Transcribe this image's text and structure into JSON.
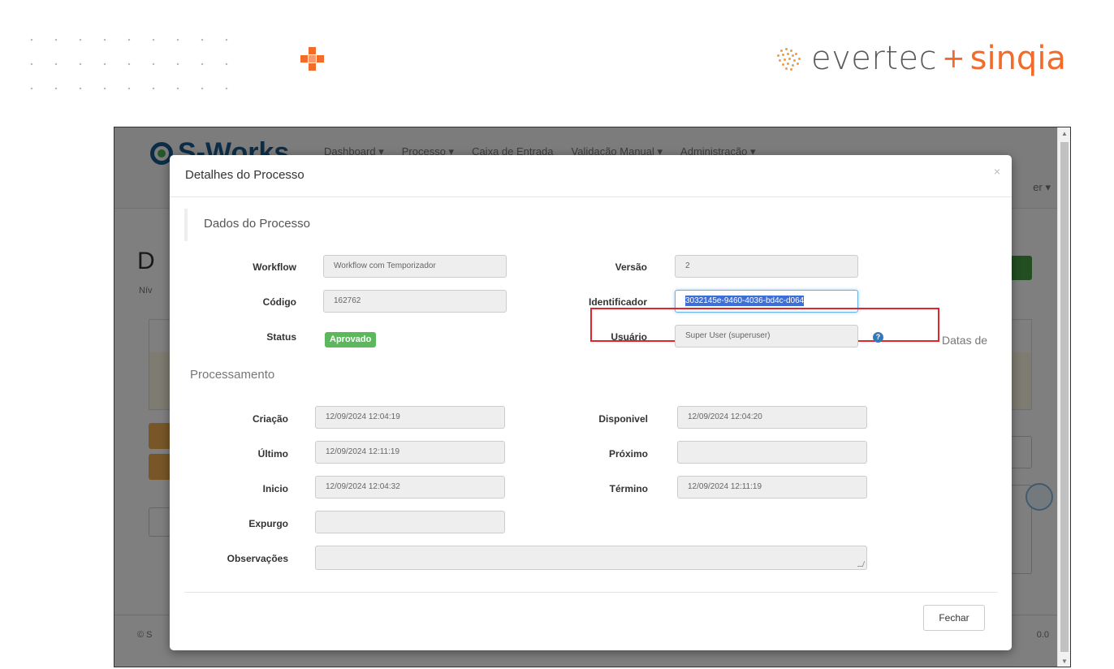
{
  "slide": {
    "logo_word1": "evertec",
    "logo_plus": "+",
    "logo_word2": "sinqia",
    "accent_color": "#f26b2a"
  },
  "app": {
    "brand": "S-Works",
    "nav": [
      "Dashboard ▾",
      "Processo ▾",
      "Caixa de Entrada",
      "Validação Manual ▾",
      "Administração ▾"
    ],
    "user_menu": "er ▾",
    "page_title": "D",
    "page_sub": "Nív",
    "footer_left": "© S",
    "footer_right": "0.0"
  },
  "modal": {
    "title": "Detalhes do Processo",
    "close": "×",
    "section_title": "Dados do Processo",
    "fields": {
      "workflow": {
        "label": "Workflow",
        "value": "Workflow com Temporizador"
      },
      "versao": {
        "label": "Versão",
        "value": "2"
      },
      "codigo": {
        "label": "Código",
        "value": "162762"
      },
      "identificador": {
        "label": "Identificador",
        "value": "3032145e-9460-4036-bd4c-d064"
      },
      "status": {
        "label": "Status",
        "value": "Aprovado"
      },
      "usuario": {
        "label": "Usuário",
        "value": "Super User (superuser)"
      },
      "criacao": {
        "label": "Criação",
        "value": "12/09/2024 12:04:19"
      },
      "disponivel": {
        "label": "Disponivel",
        "value": "12/09/2024 12:04:20"
      },
      "ultimo": {
        "label": "Último",
        "value": "12/09/2024 12:11:19"
      },
      "proximo": {
        "label": "Próximo",
        "value": ""
      },
      "inicio": {
        "label": "Inicio",
        "value": "12/09/2024 12:04:32"
      },
      "termino": {
        "label": "Término",
        "value": "12/09/2024 12:11:19"
      },
      "expurgo": {
        "label": "Expurgo",
        "value": ""
      },
      "observacoes": {
        "label": "Observações",
        "value": ""
      }
    },
    "datas_label": "Datas de",
    "processamento_label": "Processamento",
    "help_icon": "?",
    "close_button": "Fechar",
    "status_color": "#5cb85c",
    "highlight_color": "#e3242b"
  }
}
